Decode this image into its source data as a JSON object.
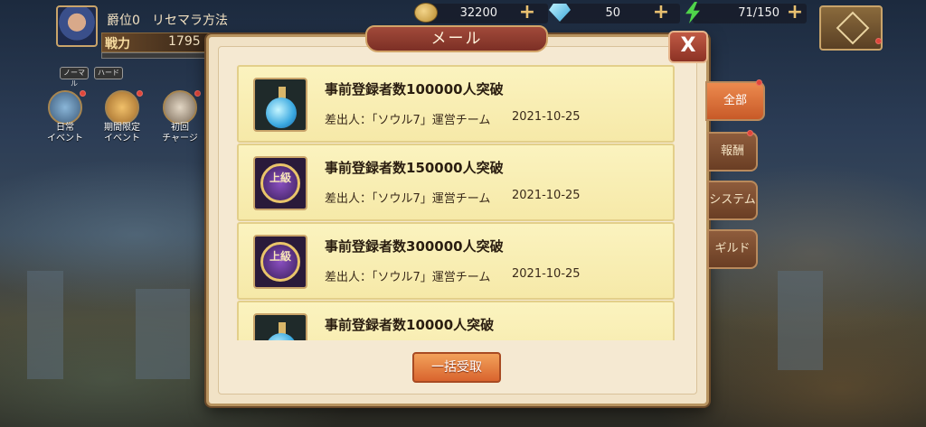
{
  "player": {
    "rank_label": "爵位0",
    "rank_name": "リセマラ方法",
    "power_label": "戦力",
    "power_value": "1795",
    "mode_tags": [
      "ノーマル",
      "ハード"
    ]
  },
  "events": [
    {
      "label_line1": "日常",
      "label_line2": "イベント"
    },
    {
      "label_line1": "期間限定",
      "label_line2": "イベント"
    },
    {
      "label_line1": "初回",
      "label_line2": "チャージ"
    }
  ],
  "resources": {
    "coins": "32200",
    "gems": "50",
    "stamina": "71/150",
    "plus_symbol": "+"
  },
  "mail": {
    "title": "メール",
    "close_label": "X",
    "bulk_receive_label": "一括受取",
    "items": [
      {
        "title": "事前登録者数100000人突破",
        "sender": "差出人：「ソウル7」運営チーム",
        "date": "2021-10-25",
        "icon": "potion-icon"
      },
      {
        "title": "事前登録者数150000人突破",
        "sender": "差出人：「ソウル7」運営チーム",
        "date": "2021-10-25",
        "icon": "advanced-seal-icon",
        "icon_text": "上級"
      },
      {
        "title": "事前登録者数300000人突破",
        "sender": "差出人：「ソウル7」運営チーム",
        "date": "2021-10-25",
        "icon": "advanced-seal-icon",
        "icon_text": "上級"
      },
      {
        "title": "事前登録者数10000人突破",
        "sender": "",
        "date": "",
        "icon": "potion-icon"
      }
    ]
  },
  "tabs": [
    {
      "label": "全部",
      "active": true
    },
    {
      "label": "報酬",
      "active": false
    },
    {
      "label": "システム",
      "active": false
    },
    {
      "label": "ギルド",
      "active": false
    }
  ]
}
